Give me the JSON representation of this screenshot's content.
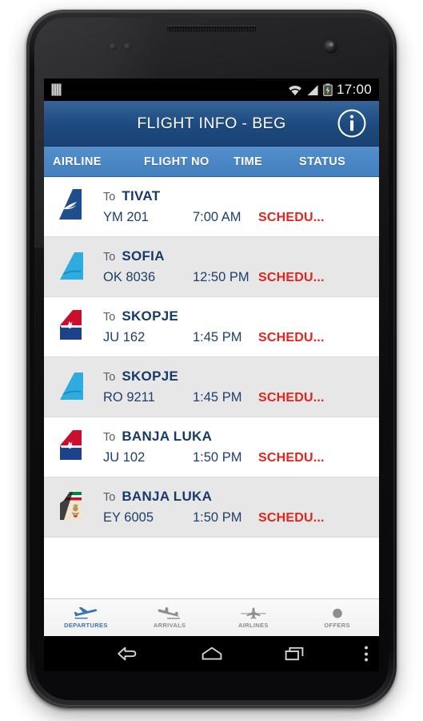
{
  "status_bar": {
    "left_icon": "sim-card-icon",
    "icons": [
      "wifi-icon",
      "cellular-signal-icon",
      "battery-charging-icon"
    ],
    "clock": "17:00"
  },
  "title_bar": {
    "title": "FLIGHT INFO - BEG",
    "info_icon": "info-icon"
  },
  "columns": {
    "airline": "AIRLINE",
    "flight_no": "FLIGHT NO",
    "time": "TIME",
    "status": "STATUS"
  },
  "to_label": "To",
  "flights": [
    {
      "logo": "montenegro-airlines-tail-icon",
      "to": "To",
      "destination": "TIVAT",
      "flight_no": "YM 201",
      "time": "7:00 AM",
      "status": "SCHEDU..."
    },
    {
      "logo": "czech-airlines-tail-icon",
      "to": "To",
      "destination": "SOFIA",
      "flight_no": "OK 8036",
      "time": "12:50 PM",
      "status": "SCHEDU..."
    },
    {
      "logo": "air-serbia-tail-icon",
      "to": "To",
      "destination": "SKOPJE",
      "flight_no": "JU 162",
      "time": "1:45 PM",
      "status": "SCHEDU..."
    },
    {
      "logo": "tarom-tail-icon",
      "to": "To",
      "destination": "SKOPJE",
      "flight_no": "RO 9211",
      "time": "1:45 PM",
      "status": "SCHEDU..."
    },
    {
      "logo": "air-serbia-tail-icon",
      "to": "To",
      "destination": "BANJA LUKA",
      "flight_no": "JU 102",
      "time": "1:50 PM",
      "status": "SCHEDU..."
    },
    {
      "logo": "etihad-tail-icon",
      "to": "To",
      "destination": "BANJA LUKA",
      "flight_no": "EY 6005",
      "time": "1:50 PM",
      "status": "SCHEDU..."
    }
  ],
  "tabs": [
    {
      "label": "DEPARTURES",
      "icon": "departures-plane-icon",
      "active": true
    },
    {
      "label": "ARRIVALS",
      "icon": "arrivals-plane-icon",
      "active": false
    },
    {
      "label": "AIRLINES",
      "icon": "airlines-plane-icon",
      "active": false
    },
    {
      "label": "OFFERS",
      "icon": "offers-circle-icon",
      "active": false
    }
  ],
  "nav_bar": {
    "back": "back-icon",
    "home": "home-icon",
    "recents": "recents-icon",
    "overflow": "overflow-menu-icon"
  },
  "colors": {
    "title_bar": "#1e4c83",
    "column_header": "#4a86c4",
    "destination": "#173a6b",
    "status": "#e3231c",
    "tab_active": "#3d73b0"
  }
}
